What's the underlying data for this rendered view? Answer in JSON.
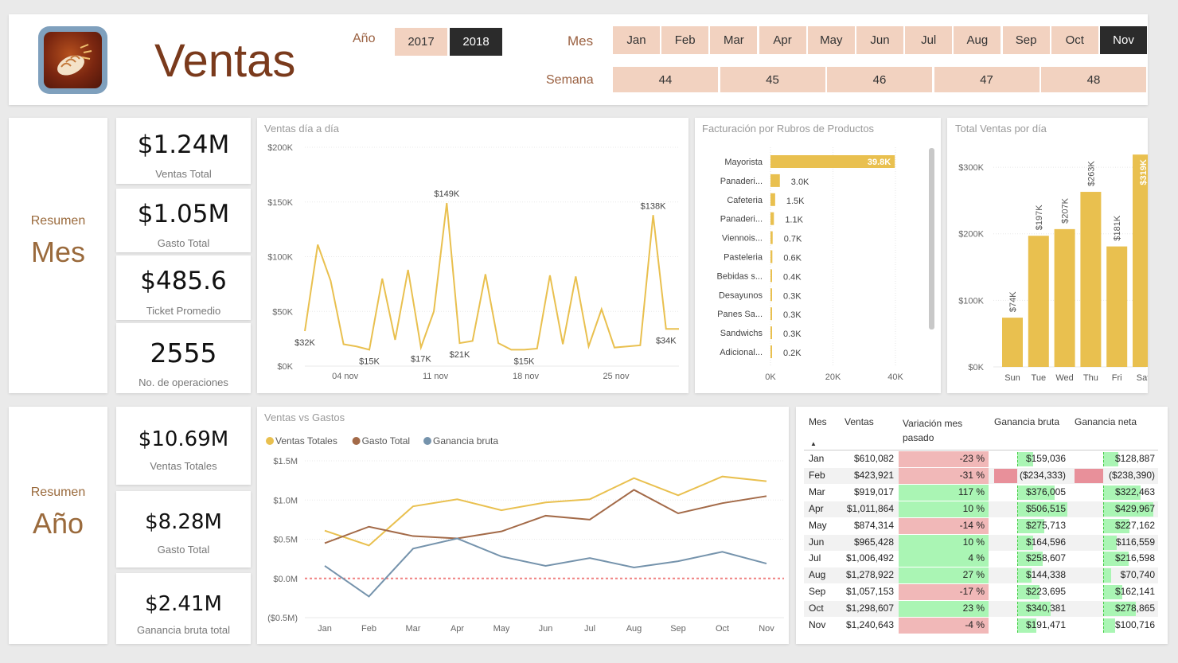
{
  "header": {
    "title": "Ventas",
    "year_label": "Año",
    "years": [
      {
        "label": "2017",
        "selected": false
      },
      {
        "label": "2018",
        "selected": true
      }
    ],
    "month_label": "Mes",
    "months": [
      {
        "label": "Jan",
        "selected": false
      },
      {
        "label": "Feb",
        "selected": false
      },
      {
        "label": "Mar",
        "selected": false
      },
      {
        "label": "Apr",
        "selected": false
      },
      {
        "label": "May",
        "selected": false
      },
      {
        "label": "Jun",
        "selected": false
      },
      {
        "label": "Jul",
        "selected": false
      },
      {
        "label": "Aug",
        "selected": false
      },
      {
        "label": "Sep",
        "selected": false
      },
      {
        "label": "Oct",
        "selected": false
      },
      {
        "label": "Nov",
        "selected": true
      }
    ],
    "week_label": "Semana",
    "weeks": [
      "44",
      "45",
      "46",
      "47",
      "48"
    ]
  },
  "resumen_mes": {
    "small": "Resumen",
    "big": "Mes"
  },
  "resumen_ano": {
    "small": "Resumen",
    "big": "Año"
  },
  "kpis_mes": [
    {
      "value": "$1.24M",
      "label": "Ventas Total"
    },
    {
      "value": "$1.05M",
      "label": "Gasto Total"
    },
    {
      "value": "$485.6",
      "label": "Ticket Promedio"
    },
    {
      "value": "2555",
      "label": "No. de operaciones"
    }
  ],
  "kpis_ano": [
    {
      "value": "$10.69M",
      "label": "Ventas Totales"
    },
    {
      "value": "$8.28M",
      "label": "Gasto Total"
    },
    {
      "value": "$2.41M",
      "label": "Ganancia bruta total"
    }
  ],
  "colors": {
    "accent": "#e9c04f",
    "brown": "#a36a48",
    "blue": "#7593ac",
    "bar": "#e9c04f",
    "pos": "#aaf5b4",
    "neg": "#f1b8b8",
    "negbar": "#e8909a"
  },
  "chart_data": [
    {
      "type": "line",
      "title": "Ventas día a día",
      "x_ticks": [
        "04 nov",
        "11 nov",
        "18 nov",
        "25 nov"
      ],
      "y_ticks": [
        "$0K",
        "$50K",
        "$100K",
        "$150K",
        "$200K"
      ],
      "ylim": [
        0,
        200000
      ],
      "x": [
        "01 nov",
        "02 nov",
        "03 nov",
        "04 nov",
        "05 nov",
        "06 nov",
        "07 nov",
        "08 nov",
        "09 nov",
        "10 nov",
        "11 nov",
        "12 nov",
        "13 nov",
        "14 nov",
        "15 nov",
        "16 nov",
        "17 nov",
        "18 nov",
        "19 nov",
        "20 nov",
        "21 nov",
        "22 nov",
        "23 nov",
        "24 nov",
        "25 nov",
        "26 nov",
        "27 nov",
        "28 nov",
        "29 nov",
        "30 nov"
      ],
      "values": [
        32000,
        111000,
        78000,
        20000,
        18000,
        15000,
        80000,
        24000,
        88000,
        17000,
        50000,
        149000,
        21000,
        23000,
        84000,
        21000,
        15000,
        15000,
        16000,
        83000,
        20000,
        82000,
        18000,
        52000,
        17000,
        18000,
        19000,
        138000,
        34000,
        34000
      ],
      "data_labels": [
        {
          "index": 0,
          "text": "$32K"
        },
        {
          "index": 5,
          "text": "$15K"
        },
        {
          "index": 9,
          "text": "$17K"
        },
        {
          "index": 11,
          "text": "$149K"
        },
        {
          "index": 12,
          "text": "$21K"
        },
        {
          "index": 17,
          "text": "$15K"
        },
        {
          "index": 27,
          "text": "$138K"
        },
        {
          "index": 28,
          "text": "$34K"
        }
      ]
    },
    {
      "type": "bar",
      "orientation": "horizontal",
      "title": "Facturación por Rubros de Productos",
      "categories": [
        "Mayorista",
        "Panaderi...",
        "Cafeteria",
        "Panaderi...",
        "Viennois...",
        "Pasteleria",
        "Bebidas s...",
        "Desayunos",
        "Panes Sa...",
        "Sandwichs",
        "Adicional..."
      ],
      "values": [
        39800,
        3000,
        1500,
        1100,
        700,
        600,
        400,
        300,
        300,
        300,
        200
      ],
      "labels": [
        "39.8K",
        "3.0K",
        "1.5K",
        "1.1K",
        "0.7K",
        "0.6K",
        "0.4K",
        "0.3K",
        "0.3K",
        "0.3K",
        "0.2K"
      ],
      "x_ticks": [
        "0K",
        "20K",
        "40K"
      ],
      "xlim": [
        0,
        40000
      ]
    },
    {
      "type": "bar",
      "title": "Total Ventas por día",
      "categories": [
        "Sun",
        "Tue",
        "Wed",
        "Thu",
        "Fri",
        "Sat"
      ],
      "values": [
        74000,
        197000,
        207000,
        263000,
        181000,
        319000
      ],
      "labels": [
        "$74K",
        "$197K",
        "$207K",
        "$263K",
        "$181K",
        "$319K"
      ],
      "y_ticks": [
        "$0K",
        "$100K",
        "$200K",
        "$300K"
      ],
      "ylim": [
        0,
        330000
      ]
    },
    {
      "type": "line",
      "title": "Ventas vs Gastos",
      "categories": [
        "Jan",
        "Feb",
        "Mar",
        "Apr",
        "May",
        "Jun",
        "Jul",
        "Aug",
        "Sep",
        "Oct",
        "Nov"
      ],
      "y_ticks": [
        "($0.5M)",
        "$0.0M",
        "$0.5M",
        "$1.0M",
        "$1.5M"
      ],
      "ylim": [
        -0.5,
        1.5
      ],
      "series": [
        {
          "name": "Ventas Totales",
          "color": "#e9c04f",
          "values": [
            0.61,
            0.42,
            0.92,
            1.01,
            0.87,
            0.97,
            1.01,
            1.28,
            1.06,
            1.3,
            1.24
          ]
        },
        {
          "name": "Gasto Total",
          "color": "#a36a48",
          "values": [
            0.45,
            0.66,
            0.54,
            0.51,
            0.6,
            0.8,
            0.75,
            1.13,
            0.83,
            0.96,
            1.05
          ]
        },
        {
          "name": "Ganancia bruta",
          "color": "#7593ac",
          "values": [
            0.16,
            -0.23,
            0.38,
            0.51,
            0.28,
            0.16,
            0.26,
            0.14,
            0.22,
            0.34,
            0.19
          ]
        }
      ]
    }
  ],
  "table": {
    "columns": [
      "Mes",
      "Ventas",
      "Variación mes pasado",
      "Ganancia bruta",
      "Ganancia neta"
    ],
    "rows": [
      {
        "mes": "Jan",
        "ventas": "$610,082",
        "var": "-23 %",
        "var_num": -23,
        "gb": "$159,036",
        "gb_num": 159036,
        "gn": "$128,887",
        "gn_num": 128887
      },
      {
        "mes": "Feb",
        "ventas": "$423,921",
        "var": "-31 %",
        "var_num": -31,
        "gb": "($234,333)",
        "gb_num": -234333,
        "gn": "($238,390)",
        "gn_num": -238390
      },
      {
        "mes": "Mar",
        "ventas": "$919,017",
        "var": "117 %",
        "var_num": 117,
        "gb": "$376,005",
        "gb_num": 376005,
        "gn": "$322,463",
        "gn_num": 322463
      },
      {
        "mes": "Apr",
        "ventas": "$1,011,864",
        "var": "10 %",
        "var_num": 10,
        "gb": "$506,515",
        "gb_num": 506515,
        "gn": "$429,967",
        "gn_num": 429967
      },
      {
        "mes": "May",
        "ventas": "$874,314",
        "var": "-14 %",
        "var_num": -14,
        "gb": "$275,713",
        "gb_num": 275713,
        "gn": "$227,162",
        "gn_num": 227162
      },
      {
        "mes": "Jun",
        "ventas": "$965,428",
        "var": "10 %",
        "var_num": 10,
        "gb": "$164,596",
        "gb_num": 164596,
        "gn": "$116,559",
        "gn_num": 116559
      },
      {
        "mes": "Jul",
        "ventas": "$1,006,492",
        "var": "4 %",
        "var_num": 4,
        "gb": "$258,607",
        "gb_num": 258607,
        "gn": "$216,598",
        "gn_num": 216598
      },
      {
        "mes": "Aug",
        "ventas": "$1,278,922",
        "var": "27 %",
        "var_num": 27,
        "gb": "$144,338",
        "gb_num": 144338,
        "gn": "$70,740",
        "gn_num": 70740
      },
      {
        "mes": "Sep",
        "ventas": "$1,057,153",
        "var": "-17 %",
        "var_num": -17,
        "gb": "$223,695",
        "gb_num": 223695,
        "gn": "$162,141",
        "gn_num": 162141
      },
      {
        "mes": "Oct",
        "ventas": "$1,298,607",
        "var": "23 %",
        "var_num": 23,
        "gb": "$340,381",
        "gb_num": 340381,
        "gn": "$278,865",
        "gn_num": 278865
      },
      {
        "mes": "Nov",
        "ventas": "$1,240,643",
        "var": "-4 %",
        "var_num": -4,
        "gb": "$191,471",
        "gb_num": 191471,
        "gn": "$100,716",
        "gn_num": 100716
      }
    ]
  }
}
